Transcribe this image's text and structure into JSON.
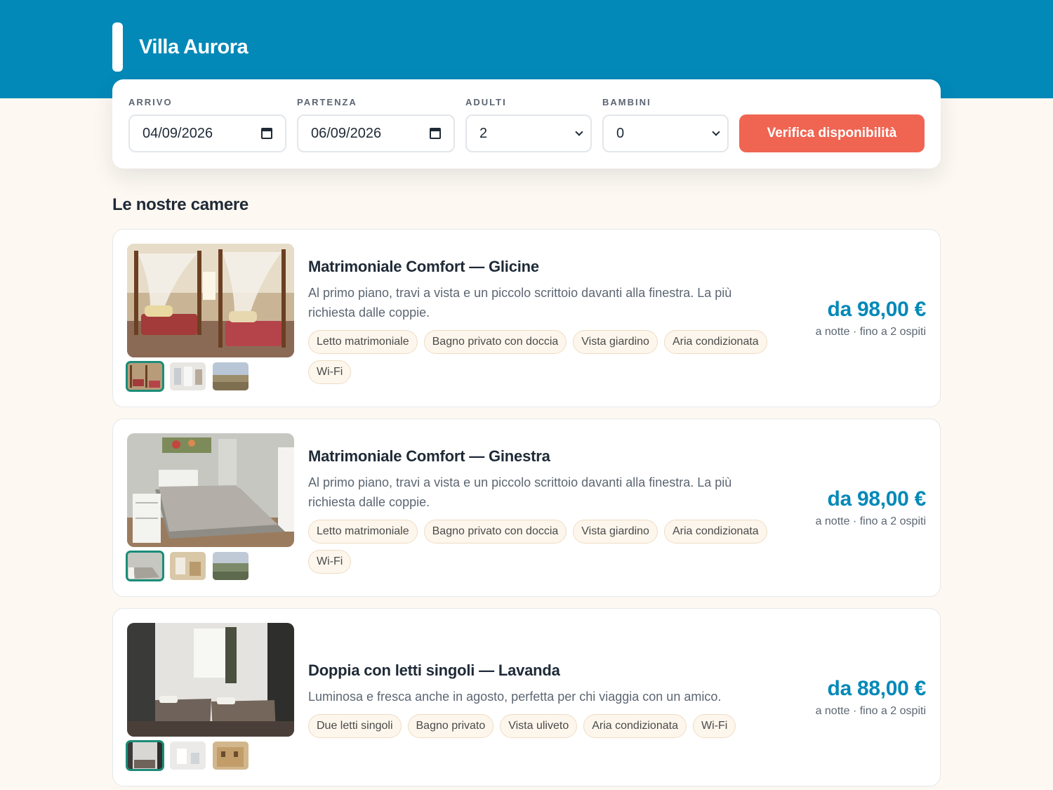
{
  "header": {
    "brand_name": "Villa Aurora",
    "colors": {
      "primary": "#0289b8",
      "accent": "#ef6552",
      "thumb_active": "#1c8c78"
    }
  },
  "search": {
    "arrival_label": "ARRIVO",
    "arrival_value": "04/09/2026",
    "departure_label": "PARTENZA",
    "departure_value": "06/09/2026",
    "adults_label": "ADULTI",
    "adults_value": "2",
    "children_label": "BAMBINI",
    "children_value": "0",
    "submit_label": "Verifica disponibilità"
  },
  "rooms_section": {
    "title": "Le nostre camere",
    "rooms": [
      {
        "title": "Matrimoniale Comfort — Glicine",
        "description": "Al primo piano, travi a vista e un piccolo scrittoio davanti alla finestra. La più richiesta dalle coppie.",
        "amenities": [
          "Letto matrimoniale",
          "Bagno privato con doccia",
          "Vista giardino",
          "Aria condizionata",
          "Wi-Fi"
        ],
        "price": "da 98,00 €",
        "price_note": "a notte · fino a 2 ospiti"
      },
      {
        "title": "Matrimoniale Comfort — Ginestra",
        "description": "Al primo piano, travi a vista e un piccolo scrittoio davanti alla finestra. La più richiesta dalle coppie.",
        "amenities": [
          "Letto matrimoniale",
          "Bagno privato con doccia",
          "Vista giardino",
          "Aria condizionata",
          "Wi-Fi"
        ],
        "price": "da 98,00 €",
        "price_note": "a notte · fino a 2 ospiti"
      },
      {
        "title": "Doppia con letti singoli — Lavanda",
        "description": "Luminosa e fresca anche in agosto, perfetta per chi viaggia con un amico.",
        "amenities": [
          "Due letti singoli",
          "Bagno privato",
          "Vista uliveto",
          "Aria condizionata",
          "Wi-Fi"
        ],
        "price": "da 88,00 €",
        "price_note": "a notte · fino a 2 ospiti"
      }
    ]
  }
}
